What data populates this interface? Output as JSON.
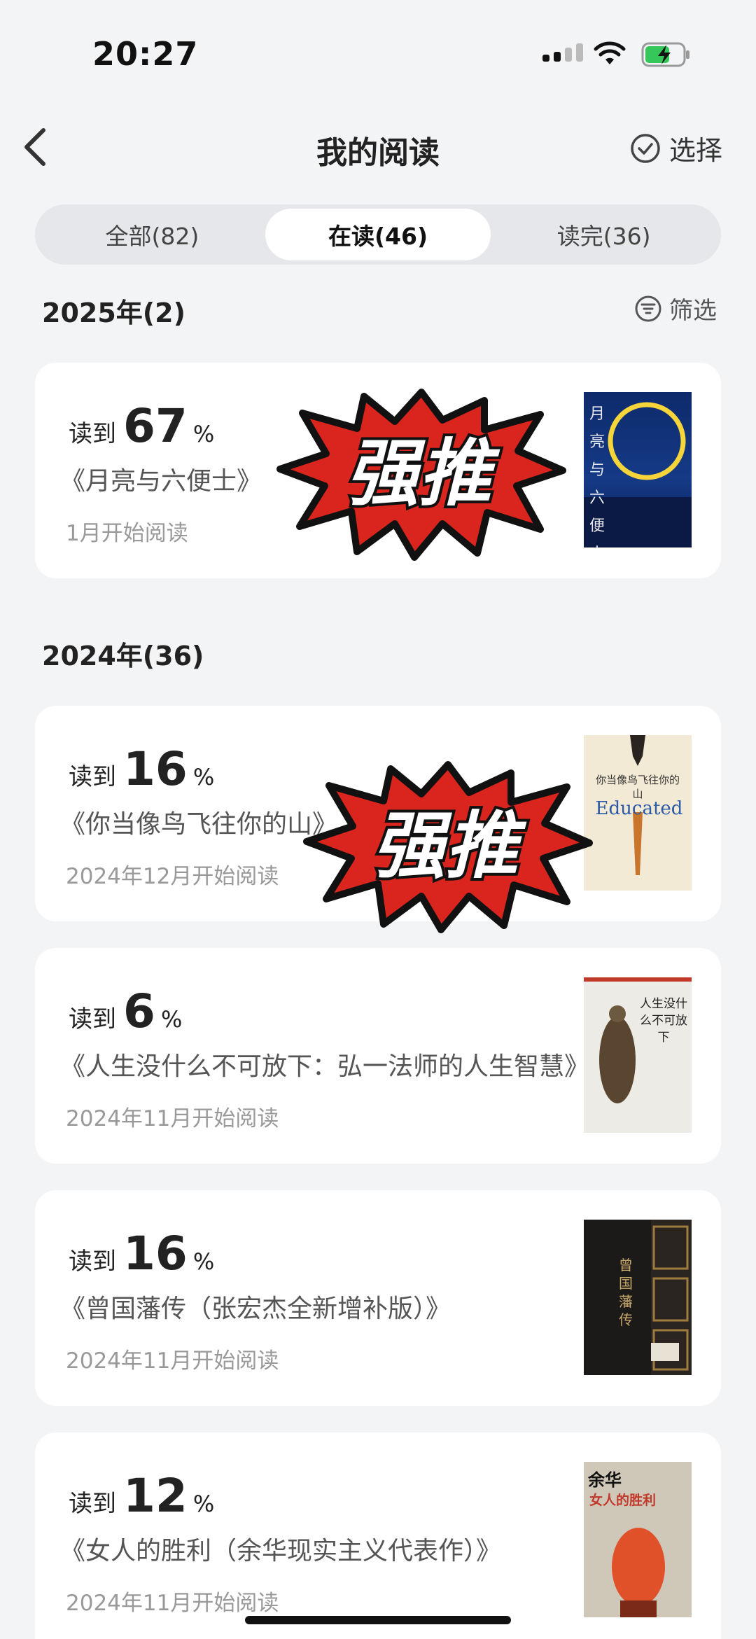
{
  "status_bar": {
    "time": "20:27"
  },
  "header": {
    "title": "我的阅读",
    "select_label": "选择"
  },
  "tabs": [
    {
      "label": "全部(82)",
      "active": false
    },
    {
      "label": "在读(46)",
      "active": true
    },
    {
      "label": "读完(36)",
      "active": false
    }
  ],
  "sections": [
    {
      "label": "2025年(2)",
      "filter_label": "筛选"
    },
    {
      "label": "2024年(36)"
    }
  ],
  "books": [
    {
      "prefix": "读到",
      "percent": "67",
      "unit": "%",
      "title": "《月亮与六便士》",
      "date": "1月开始阅读",
      "cover_title": "月亮与六便士",
      "sticker": "强推"
    },
    {
      "prefix": "读到",
      "percent": "16",
      "unit": "%",
      "title": "《你当像鸟飞往你的山》",
      "date": "2024年12月开始阅读",
      "cover_title": "你当像鸟飞往你的山",
      "cover_sub": "Educated",
      "sticker": "强推"
    },
    {
      "prefix": "读到",
      "percent": "6",
      "unit": "%",
      "title": "《人生没什么不可放下：弘一法师的人生智慧》",
      "date": "2024年11月开始阅读",
      "cover_title": "人生没什么不可放下"
    },
    {
      "prefix": "读到",
      "percent": "16",
      "unit": "%",
      "title": "《曾国藩传（张宏杰全新增补版）》",
      "date": "2024年11月开始阅读",
      "cover_title": "曾国藩传"
    },
    {
      "prefix": "读到",
      "percent": "12",
      "unit": "%",
      "title": "《女人的胜利（余华现实主义代表作）》",
      "date": "2024年11月开始阅读",
      "cover_title": "女人的胜利",
      "cover_author": "余华"
    }
  ],
  "colors": {
    "sticker_red": "#d9251d",
    "background": "#f3f4f6",
    "card": "#ffffff"
  }
}
